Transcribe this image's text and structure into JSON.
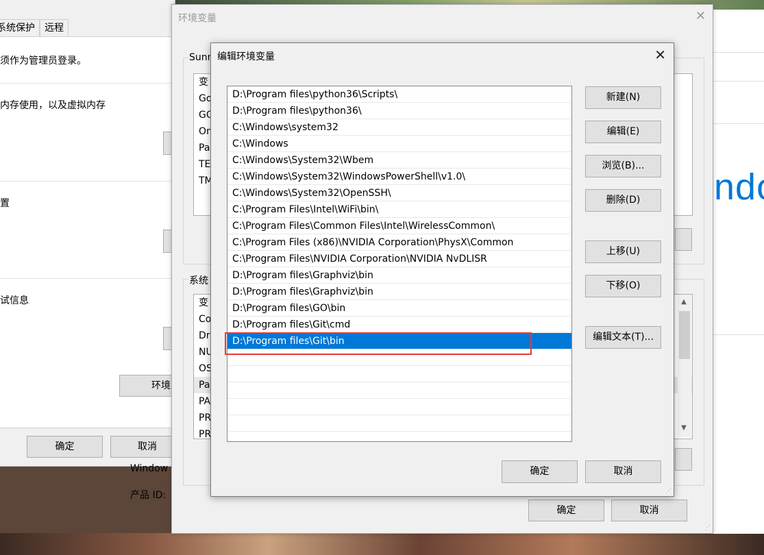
{
  "system_properties": {
    "tabs": [
      "系统保护",
      "远程"
    ],
    "admin_note": "须作为管理员登录。",
    "performance_text": "内存使用，以及虚拟内存",
    "profile_text": "置",
    "startup_text": "试信息",
    "env_button_label": "环境",
    "ok_label": "确定",
    "cancel_label": "取消"
  },
  "background_texts": {
    "windows_label": "Window",
    "product_id_label": "产品 ID:",
    "brand_text": "ndo"
  },
  "env_vars_window": {
    "title": "环境变量",
    "close_glyph": "✕",
    "user_group_label": "Sunn",
    "user_list": [
      "变",
      "Go",
      "GO",
      "On",
      "Pa",
      "TE",
      "TM"
    ],
    "system_group_label": "系统",
    "system_list": [
      "变",
      "Co",
      "Dr",
      "NU",
      "OS",
      "Pa",
      "PA",
      "PR",
      "PR"
    ],
    "ok_label": "确定",
    "cancel_label": "取消"
  },
  "edit_dialog": {
    "title": "编辑环境变量",
    "close_glyph": "✕",
    "paths": [
      "D:\\Program files\\python36\\Scripts\\",
      "D:\\Program files\\python36\\",
      "C:\\Windows\\system32",
      "C:\\Windows",
      "C:\\Windows\\System32\\Wbem",
      "C:\\Windows\\System32\\WindowsPowerShell\\v1.0\\",
      "C:\\Windows\\System32\\OpenSSH\\",
      "C:\\Program Files\\Intel\\WiFi\\bin\\",
      "C:\\Program Files\\Common Files\\Intel\\WirelessCommon\\",
      "C:\\Program Files (x86)\\NVIDIA Corporation\\PhysX\\Common",
      "C:\\Program Files\\NVIDIA Corporation\\NVIDIA NvDLISR",
      "D:\\Program files\\Graphviz\\bin",
      "D:\\Program files\\Graphviz\\bin",
      "D:\\Program files\\GO\\bin",
      "D:\\Program files\\Git\\cmd",
      "D:\\Program files\\Git\\bin"
    ],
    "selected_index": 15,
    "empty_rows": 5,
    "buttons": {
      "new": "新建(N)",
      "edit": "编辑(E)",
      "browse": "浏览(B)...",
      "delete": "删除(D)",
      "move_up": "上移(U)",
      "move_down": "下移(O)",
      "edit_text": "编辑文本(T)..."
    },
    "ok_label": "确定",
    "cancel_label": "取消"
  },
  "colors": {
    "selection": "#0078d7",
    "highlight_box": "#e53935",
    "brand_blue": "#0078d7"
  }
}
